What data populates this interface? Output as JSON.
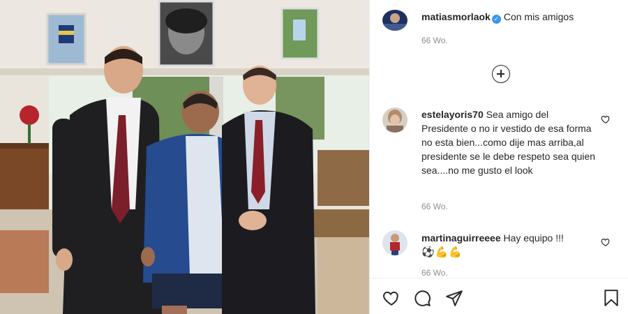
{
  "post": {
    "author": "matiasmorlaok",
    "verified": true,
    "caption": "Con mis amigos",
    "caption_time": "66 Wo."
  },
  "comments": [
    {
      "username": "estelayoris70",
      "text": "Sea amigo del Presidente o no ir vestido de esa forma no esta bien...como dije mas arriba,al presidente se le debe respeto sea quien sea....no me gusto el look",
      "time": "66 Wo."
    },
    {
      "username": "martinaguirreeee",
      "text": "Hay equipo !!!",
      "emoji": "⚽💪💪",
      "time": "66 Wo."
    }
  ],
  "icons": {
    "load_more": "plus-circle-icon",
    "like": "heart-icon",
    "comment": "comment-bubble-icon",
    "share": "paper-plane-icon",
    "save": "bookmark-icon"
  },
  "colors": {
    "text": "#262626",
    "secondary": "#8e8e8e",
    "verified": "#3897f0",
    "border": "#efefef"
  }
}
